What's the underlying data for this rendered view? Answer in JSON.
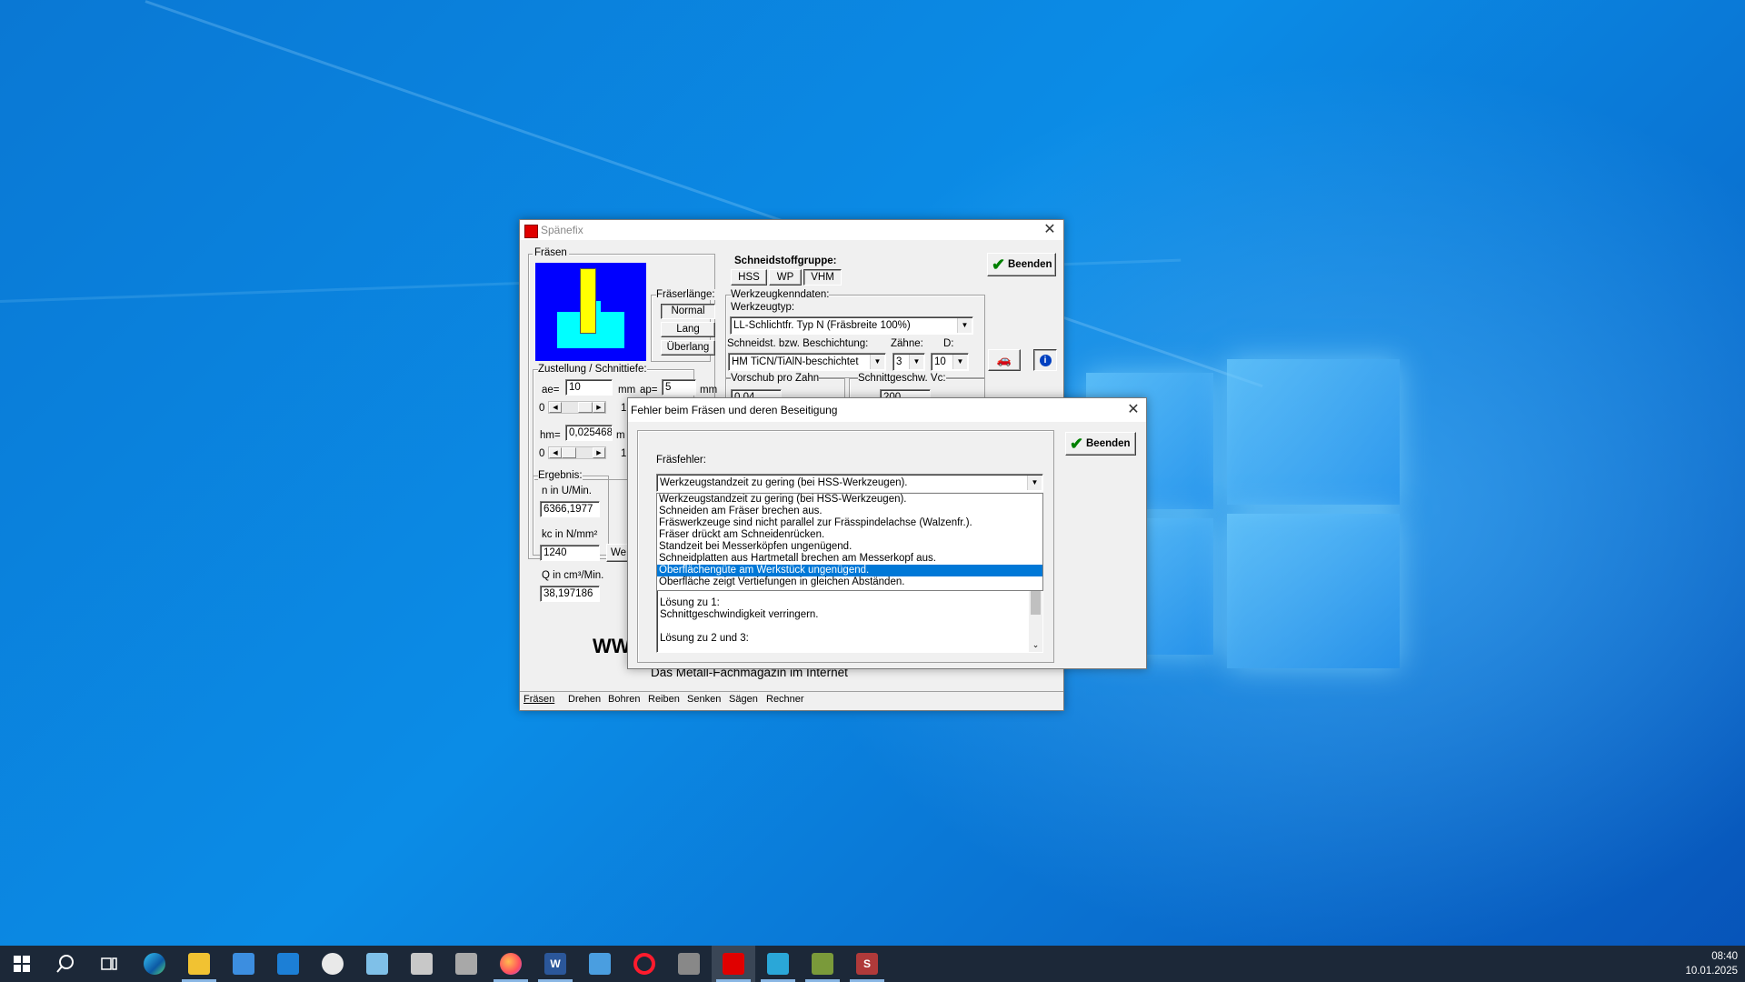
{
  "main": {
    "title": "Spänefix",
    "section_fraesen": "Fräsen",
    "schneidstoffgruppe": {
      "label": "Schneidstoffgruppe:",
      "options": [
        "HSS",
        "WP",
        "VHM"
      ]
    },
    "beenden_label": "Beenden",
    "fraeserlaenge": {
      "label": "Fräserlänge:",
      "options": [
        "Normal",
        "Lang",
        "Überlang"
      ]
    },
    "werkzeugkenndaten": {
      "label": "Werkzeugkenndaten:",
      "werkzeugtyp_label": "Werkzeugtyp:",
      "werkzeugtyp_value": "LL-Schlichtfr. Typ N (Fräsbreite 100%)",
      "beschichtung_label": "Schneidst. bzw. Beschichtung:",
      "beschichtung_value": "HM TiCN/TiAlN-beschichtet",
      "zaehne_label": "Zähne:",
      "zaehne_value": "3",
      "d_label": "D:",
      "d_value": "10"
    },
    "zustellung": {
      "label": "Zustellung / Schnittiefe:",
      "ae_label": "ae=",
      "ae_value": "10",
      "ae_unit": "mm",
      "ap_label": "ap=",
      "ap_value": "5",
      "ap_unit": "mm",
      "scroll_min": "0",
      "scroll_max": "1"
    },
    "hm": {
      "label": "hm=",
      "value": "0,025468",
      "unit": "m",
      "scroll_min": "0",
      "scroll_max": "1"
    },
    "vorschub_label": "Vorschub pro Zahn",
    "vorschub_value": "0,04",
    "schnittgeschw_label": "Schnittgeschw. Vc:",
    "schnittgeschw_value": "200",
    "ergebnis": {
      "label": "Ergebnis:",
      "n_label": "n in U/Min.",
      "n_value": "6366,1977",
      "kc_label": "kc in N/mm²",
      "kc_value": "1240",
      "kc_button": "We",
      "q_label": "Q in cm³/Min.",
      "q_value": "38,197186"
    },
    "banner_partial": "WW",
    "slogan": "Das Metall-Fachmagazin im Internet",
    "tabs": [
      "Fräsen",
      "Drehen",
      "Bohren",
      "Reiben",
      "Senken",
      "Sägen",
      "Rechner"
    ]
  },
  "dialog": {
    "title": "Fehler beim Fräsen und deren Beseitigung",
    "beenden_label": "Beenden",
    "fraesfehler_label": "Fräsfehler:",
    "selected": "Werkzeugstandzeit zu gering (bei HSS-Werkzeugen).",
    "options": [
      "Werkzeugstandzeit zu gering (bei HSS-Werkzeugen).",
      "Schneiden am Fräser brechen aus.",
      "Fräswerkzeuge sind nicht parallel zur Frässpindelachse (Walzenfr.).",
      "Fräser drückt am Schneidenrücken.",
      "Standzeit bei Messerköpfen ungenügend.",
      "Schneidplatten aus Hartmetall brechen am Messerkopf aus.",
      "Oberflächengüte am Werkstück ungenügend.",
      "Oberfläche zeigt Vertiefungen in gleichen Abständen."
    ],
    "highlighted_index": 6,
    "text_lines": [
      "Lösung zu 1:",
      "Schnittgeschwindigkeit verringern.",
      "",
      "Lösung zu 2 und 3:"
    ]
  },
  "taskbar": {
    "time": "08:40",
    "date": "10.01.2025",
    "icons": [
      "start-icon",
      "search-icon",
      "task-view-icon",
      "edge-icon",
      "file-explorer-icon",
      "store-icon",
      "mail-icon",
      "paint-icon",
      "notepad-icon",
      "printer-icon",
      "calculator-icon",
      "firefox-icon",
      "word-icon",
      "app-icon",
      "opera-icon",
      "usb-icon",
      "spaenefix-icon",
      "camera-icon",
      "photo-icon",
      "s-app-icon"
    ]
  }
}
